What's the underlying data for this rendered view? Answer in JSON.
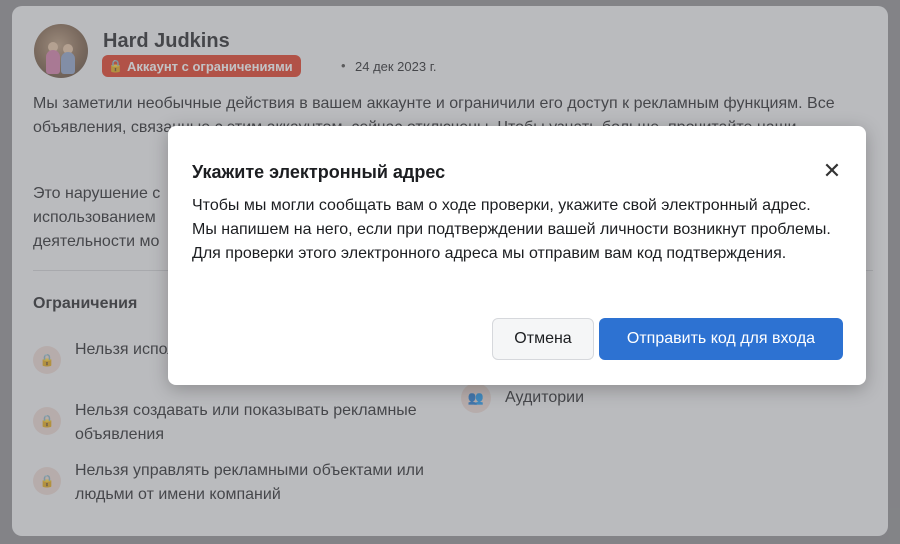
{
  "post": {
    "author": "Hard Judkins",
    "badge": "Аккаунт с ограничениями",
    "separator": "•",
    "date": "24 дек 2023 г.",
    "paragraph1": "Мы заметили необычные действия в вашем аккаунте и ограничили его доступ к рекламным функциям. Все объявления, связанные с этим аккаунтом, сейчас отключены. Чтобы узнать больше, прочитайте наши",
    "paragraph2": "Это нарушение с использованием деятельности мо",
    "section_title": "Ограничения",
    "restrictions": [
      {
        "text": "Нельзя использовать или управлять"
      },
      {
        "text": "Нельзя создавать или показывать рекламные объявления"
      },
      {
        "text": "Нельзя управлять рекламными объектами или людьми от имени компаний"
      }
    ],
    "audiences_label": "Аудитории"
  },
  "modal": {
    "title": "Укажите электронный адрес",
    "body": "Чтобы мы могли сообщать вам о ходе проверки, укажите свой электронный адрес. Мы напишем на него, если при подтверждении вашей личности возникнут проблемы. Для проверки этого электронного адреса мы отправим вам код подтверждения.",
    "close_icon": "✕",
    "cancel_label": "Отмена",
    "send_label": "Отправить код для входа"
  },
  "colors": {
    "badge": "#e0341c",
    "primary_button": "#2d72d2"
  }
}
